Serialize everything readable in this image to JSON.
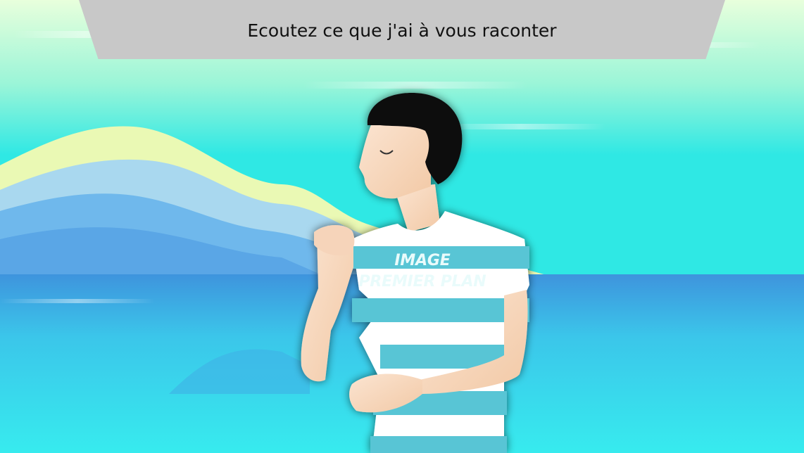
{
  "banner": {
    "caption": "Ecoutez ce que j'ai à vous raconter"
  },
  "foreground": {
    "label_line_1": "IMAGE",
    "label_line_2": "PREMIER PLAN"
  },
  "colors": {
    "sky_top": "#e6ffe0",
    "sky_bottom": "#2fe8e4",
    "banner": "#c8c8c8",
    "hill_yellow": "#eaf9b4",
    "hill_blue_light": "#a9d8ef",
    "hill_blue": "#6fb8ec",
    "sea": "#3da0e3",
    "sea_near": "#37e8ef",
    "hair": "#111111",
    "skin": "#f7d9c1",
    "stripe": "#59c5d5"
  }
}
